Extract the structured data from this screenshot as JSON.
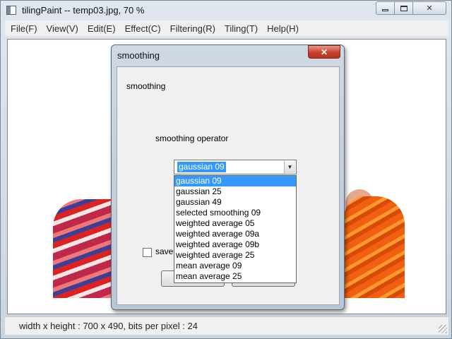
{
  "window": {
    "title": "tilingPaint -- temp03.jpg, 70 %"
  },
  "menu": {
    "items": [
      {
        "label": "File(F)"
      },
      {
        "label": "View(V)"
      },
      {
        "label": "Edit(E)"
      },
      {
        "label": "Effect(C)"
      },
      {
        "label": "Filtering(R)"
      },
      {
        "label": "Tiling(T)"
      },
      {
        "label": "Help(H)"
      }
    ]
  },
  "status": {
    "text": "width x height : 700 x 490, bits per pixel : 24"
  },
  "dialog": {
    "title": "smoothing",
    "close_glyph": "✕",
    "group_label": "smoothing",
    "operator_label": "smoothing operator",
    "combo": {
      "selected": "gaussian 09",
      "arrow_glyph": "▼",
      "options": [
        "gaussian 09",
        "gaussian 25",
        "gaussian 49",
        "selected smoothing 09",
        "weighted average 05",
        "weighted average 09a",
        "weighted average 09b",
        "weighted average 25",
        "mean average 09",
        "mean average 25"
      ],
      "highlighted_index": 0
    },
    "save_checkbox_label": "save",
    "save_checked": false
  },
  "colors": {
    "selection": "#3399ff",
    "close_button": "#c8402a"
  },
  "icons": {
    "app": "app-window-icon",
    "minimize": "minimize-icon",
    "maximize": "maximize-icon",
    "close": "close-icon",
    "dropdown": "chevron-down-icon"
  }
}
